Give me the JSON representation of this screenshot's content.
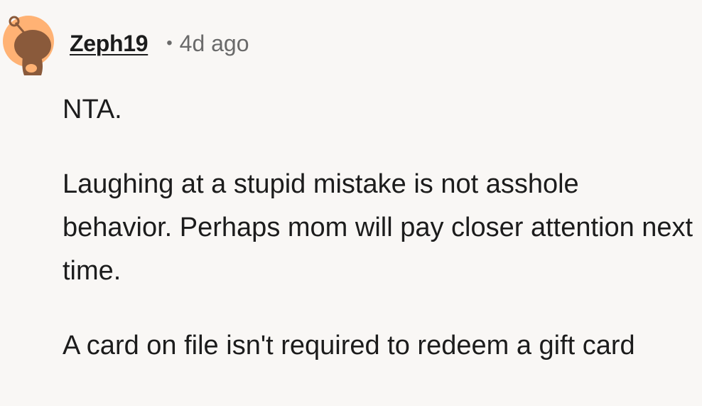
{
  "comment": {
    "author": "Zeph19",
    "separator": "•",
    "timestamp": "4d ago",
    "avatar_icon": "snoo-avatar-icon",
    "paragraphs": [
      "NTA.",
      "Laughing at a stupid mistake is not asshole behavior. Perhaps mom will pay closer attention next time.",
      "A card on file isn't required to redeem a gift card"
    ]
  },
  "colors": {
    "background": "#f9f7f5",
    "avatar_bg": "#ffb274",
    "avatar_figure": "#8a5a3b",
    "text": "#1c1c1c",
    "meta": "#6a6a6a"
  }
}
